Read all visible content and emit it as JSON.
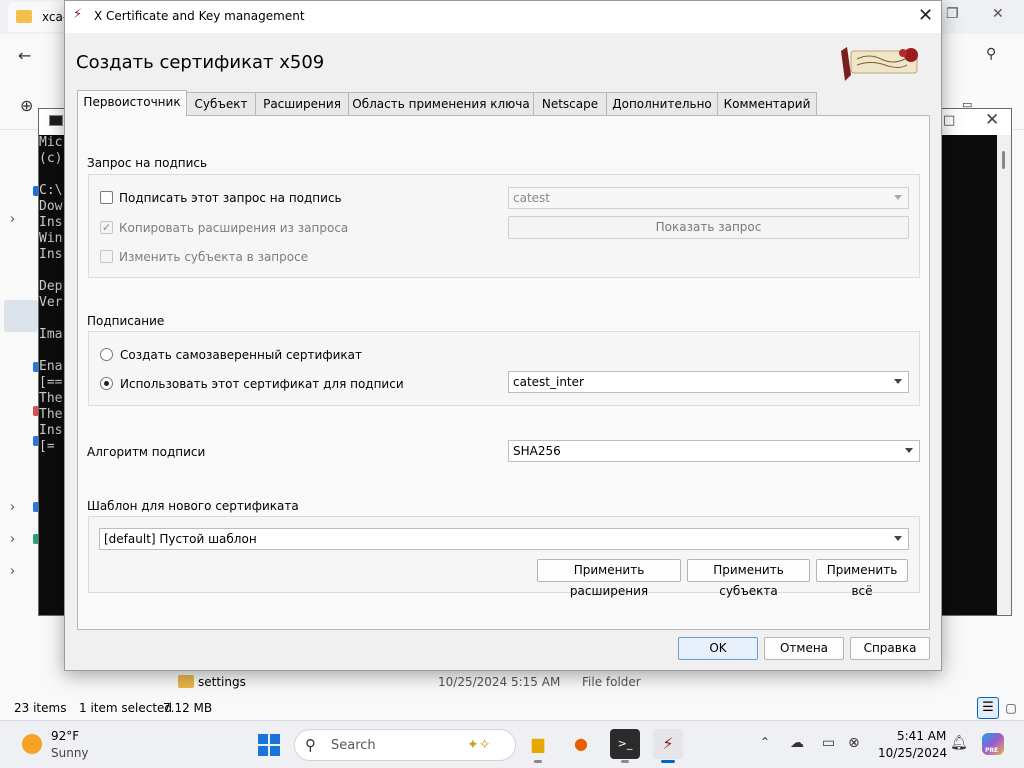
{
  "explorer": {
    "tab_title": "xca-",
    "row": {
      "name": "settings",
      "date": "10/25/2024 5:15 AM",
      "type": "File folder"
    },
    "status": {
      "items": "23 items",
      "selected": "1 item selected",
      "size": "7.12 MB"
    }
  },
  "console": {
    "lines": [
      "Mic",
      "(c)",
      "",
      "C:\\",
      "Dow",
      "Ins",
      "Win",
      "Ins",
      "",
      "Dep",
      "Ver",
      "",
      "Ima",
      "",
      "Ena",
      "[==",
      "The",
      "The",
      "Ins",
      "[="
    ]
  },
  "dialog": {
    "window_title": "X Certificate and Key management",
    "heading": "Создать сертификат x509",
    "tabs": [
      "Первоисточник",
      "Субъект",
      "Расширения",
      "Область применения ключа",
      "Netscape",
      "Дополнительно",
      "Комментарий"
    ],
    "active_tab": 0,
    "signing_request": {
      "title": "Запрос на подпись",
      "sign_request_label": "Подписать этот запрос на подпись",
      "sign_request_checked": false,
      "copy_extensions_label": "Копировать расширения из запроса",
      "copy_extensions_checked": true,
      "change_subject_label": "Изменить субъекта в запросе",
      "change_subject_checked": false,
      "request_value": "catest",
      "show_request_button": "Показать запрос"
    },
    "signing": {
      "title": "Подписание",
      "self_signed_label": "Создать самозаверенный сертификат",
      "use_cert_label": "Использовать этот сертификат для подписи",
      "selected_option": "use_cert",
      "ca_cert_value": "catest_inter"
    },
    "algorithm": {
      "label": "Алгоритм подписи",
      "value": "SHA256"
    },
    "template": {
      "title": "Шаблон для нового сертификата",
      "value": "[default] Пустой шаблон",
      "apply_extensions": "Применить расширения",
      "apply_subject": "Применить субъекта",
      "apply_all": "Применить всё"
    },
    "buttons": {
      "ok": "OK",
      "cancel": "Отмена",
      "help": "Справка"
    }
  },
  "taskbar": {
    "weather_temp": "92°F",
    "weather_condition": "Sunny",
    "search_placeholder": "Search",
    "time": "5:41 AM",
    "date": "10/25/2024",
    "copilot_badge": "PRE"
  },
  "colors": {
    "accent": "#0067c0",
    "dialog_bg": "#f0f0f0",
    "console_bg": "#0c0c0c",
    "folder": "#f3c04b"
  }
}
